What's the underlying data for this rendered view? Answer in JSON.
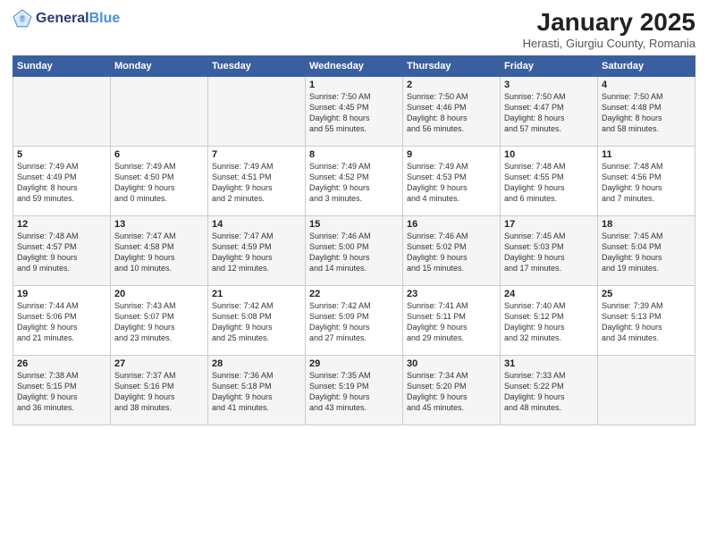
{
  "header": {
    "logo_general": "General",
    "logo_blue": "Blue",
    "month_title": "January 2025",
    "location": "Herasti, Giurgiu County, Romania"
  },
  "weekdays": [
    "Sunday",
    "Monday",
    "Tuesday",
    "Wednesday",
    "Thursday",
    "Friday",
    "Saturday"
  ],
  "weeks": [
    [
      {
        "day": "",
        "info": ""
      },
      {
        "day": "",
        "info": ""
      },
      {
        "day": "",
        "info": ""
      },
      {
        "day": "1",
        "info": "Sunrise: 7:50 AM\nSunset: 4:45 PM\nDaylight: 8 hours\nand 55 minutes."
      },
      {
        "day": "2",
        "info": "Sunrise: 7:50 AM\nSunset: 4:46 PM\nDaylight: 8 hours\nand 56 minutes."
      },
      {
        "day": "3",
        "info": "Sunrise: 7:50 AM\nSunset: 4:47 PM\nDaylight: 8 hours\nand 57 minutes."
      },
      {
        "day": "4",
        "info": "Sunrise: 7:50 AM\nSunset: 4:48 PM\nDaylight: 8 hours\nand 58 minutes."
      }
    ],
    [
      {
        "day": "5",
        "info": "Sunrise: 7:49 AM\nSunset: 4:49 PM\nDaylight: 8 hours\nand 59 minutes."
      },
      {
        "day": "6",
        "info": "Sunrise: 7:49 AM\nSunset: 4:50 PM\nDaylight: 9 hours\nand 0 minutes."
      },
      {
        "day": "7",
        "info": "Sunrise: 7:49 AM\nSunset: 4:51 PM\nDaylight: 9 hours\nand 2 minutes."
      },
      {
        "day": "8",
        "info": "Sunrise: 7:49 AM\nSunset: 4:52 PM\nDaylight: 9 hours\nand 3 minutes."
      },
      {
        "day": "9",
        "info": "Sunrise: 7:49 AM\nSunset: 4:53 PM\nDaylight: 9 hours\nand 4 minutes."
      },
      {
        "day": "10",
        "info": "Sunrise: 7:48 AM\nSunset: 4:55 PM\nDaylight: 9 hours\nand 6 minutes."
      },
      {
        "day": "11",
        "info": "Sunrise: 7:48 AM\nSunset: 4:56 PM\nDaylight: 9 hours\nand 7 minutes."
      }
    ],
    [
      {
        "day": "12",
        "info": "Sunrise: 7:48 AM\nSunset: 4:57 PM\nDaylight: 9 hours\nand 9 minutes."
      },
      {
        "day": "13",
        "info": "Sunrise: 7:47 AM\nSunset: 4:58 PM\nDaylight: 9 hours\nand 10 minutes."
      },
      {
        "day": "14",
        "info": "Sunrise: 7:47 AM\nSunset: 4:59 PM\nDaylight: 9 hours\nand 12 minutes."
      },
      {
        "day": "15",
        "info": "Sunrise: 7:46 AM\nSunset: 5:00 PM\nDaylight: 9 hours\nand 14 minutes."
      },
      {
        "day": "16",
        "info": "Sunrise: 7:46 AM\nSunset: 5:02 PM\nDaylight: 9 hours\nand 15 minutes."
      },
      {
        "day": "17",
        "info": "Sunrise: 7:45 AM\nSunset: 5:03 PM\nDaylight: 9 hours\nand 17 minutes."
      },
      {
        "day": "18",
        "info": "Sunrise: 7:45 AM\nSunset: 5:04 PM\nDaylight: 9 hours\nand 19 minutes."
      }
    ],
    [
      {
        "day": "19",
        "info": "Sunrise: 7:44 AM\nSunset: 5:06 PM\nDaylight: 9 hours\nand 21 minutes."
      },
      {
        "day": "20",
        "info": "Sunrise: 7:43 AM\nSunset: 5:07 PM\nDaylight: 9 hours\nand 23 minutes."
      },
      {
        "day": "21",
        "info": "Sunrise: 7:42 AM\nSunset: 5:08 PM\nDaylight: 9 hours\nand 25 minutes."
      },
      {
        "day": "22",
        "info": "Sunrise: 7:42 AM\nSunset: 5:09 PM\nDaylight: 9 hours\nand 27 minutes."
      },
      {
        "day": "23",
        "info": "Sunrise: 7:41 AM\nSunset: 5:11 PM\nDaylight: 9 hours\nand 29 minutes."
      },
      {
        "day": "24",
        "info": "Sunrise: 7:40 AM\nSunset: 5:12 PM\nDaylight: 9 hours\nand 32 minutes."
      },
      {
        "day": "25",
        "info": "Sunrise: 7:39 AM\nSunset: 5:13 PM\nDaylight: 9 hours\nand 34 minutes."
      }
    ],
    [
      {
        "day": "26",
        "info": "Sunrise: 7:38 AM\nSunset: 5:15 PM\nDaylight: 9 hours\nand 36 minutes."
      },
      {
        "day": "27",
        "info": "Sunrise: 7:37 AM\nSunset: 5:16 PM\nDaylight: 9 hours\nand 38 minutes."
      },
      {
        "day": "28",
        "info": "Sunrise: 7:36 AM\nSunset: 5:18 PM\nDaylight: 9 hours\nand 41 minutes."
      },
      {
        "day": "29",
        "info": "Sunrise: 7:35 AM\nSunset: 5:19 PM\nDaylight: 9 hours\nand 43 minutes."
      },
      {
        "day": "30",
        "info": "Sunrise: 7:34 AM\nSunset: 5:20 PM\nDaylight: 9 hours\nand 45 minutes."
      },
      {
        "day": "31",
        "info": "Sunrise: 7:33 AM\nSunset: 5:22 PM\nDaylight: 9 hours\nand 48 minutes."
      },
      {
        "day": "",
        "info": ""
      }
    ]
  ]
}
